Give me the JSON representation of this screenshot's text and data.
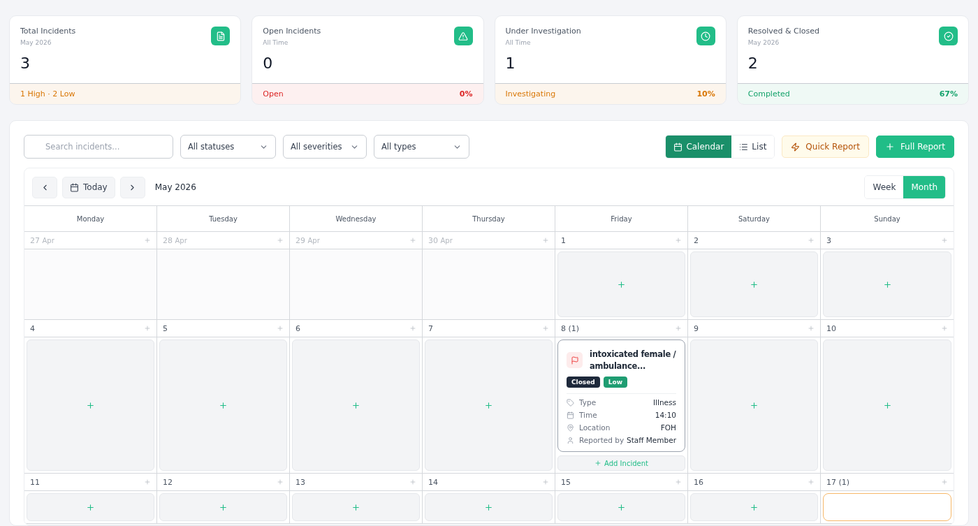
{
  "stats": [
    {
      "title": "Total Incidents",
      "subtitle": "May 2026",
      "value": "3",
      "color": "#d97706",
      "footer": "1 High · 2 Low"
    },
    {
      "title": "Open Incidents",
      "subtitle": "All Time",
      "value": "0",
      "color": "#dc2626",
      "footer": "Open",
      "percent": "0%"
    },
    {
      "title": "Under Investigation",
      "subtitle": "All Time",
      "value": "1",
      "color": "#d97706",
      "footer": "Investigating",
      "percent": "10%"
    },
    {
      "title": "Resolved & Closed",
      "subtitle": "May 2026",
      "value": "2",
      "color": "#16a36c",
      "footer": "Completed",
      "percent": "67%"
    }
  ],
  "filters": {
    "search_placeholder": "Search incidents...",
    "selects": [
      "All statuses",
      "All severities",
      "All types"
    ]
  },
  "view_tabs": [
    {
      "label": "Calendar",
      "selected": true
    },
    {
      "label": "List",
      "selected": false
    }
  ],
  "actions": [
    {
      "label": "Quick Report",
      "kind": "quick"
    },
    {
      "label": "Full Report",
      "kind": "full"
    }
  ],
  "calendar": {
    "today_label": "Today",
    "period": "May 2026",
    "range_tabs": [
      {
        "label": "Week",
        "selected": false
      },
      {
        "label": "Month",
        "selected": true
      }
    ],
    "weekdays": [
      "Monday",
      "Tuesday",
      "Wednesday",
      "Thursday",
      "Friday",
      "Saturday",
      "Sunday"
    ],
    "weeks": [
      [
        {
          "date": "27",
          "month": "Apr",
          "outside": true
        },
        {
          "date": "28",
          "month": "Apr",
          "outside": true
        },
        {
          "date": "29",
          "month": "Apr",
          "outside": true
        },
        {
          "date": "30",
          "month": "Apr",
          "outside": true
        },
        {
          "date": "1",
          "outside": false
        },
        {
          "date": "2",
          "outside": false
        },
        {
          "date": "3",
          "outside": false
        }
      ],
      [
        {
          "date": "4",
          "outside": false
        },
        {
          "date": "5",
          "outside": false
        },
        {
          "date": "6",
          "outside": false
        },
        {
          "date": "7",
          "outside": false
        },
        {
          "date": "8",
          "count": "(1)",
          "outside": false,
          "add_label": "Add Incident",
          "incidents": [
            {
              "title": "intoxicated female / ambulance...",
              "status": "Closed",
              "severity": "Low",
              "details": [
                {
                  "label": "Type",
                  "value": "Illness"
                },
                {
                  "label": "Time",
                  "value": "14:10"
                },
                {
                  "label": "Location",
                  "value": "FOH"
                },
                {
                  "label": "Reported by",
                  "value": "Staff Member"
                }
              ]
            }
          ]
        },
        {
          "date": "9",
          "outside": false
        },
        {
          "date": "10",
          "outside": false
        }
      ],
      [
        {
          "date": "11",
          "outside": false
        },
        {
          "date": "12",
          "outside": false
        },
        {
          "date": "13",
          "outside": false
        },
        {
          "date": "14",
          "outside": false
        },
        {
          "date": "15",
          "outside": false
        },
        {
          "date": "16",
          "outside": false
        },
        {
          "date": "17",
          "count": "(1)",
          "outside": false,
          "card_peek": true
        }
      ]
    ]
  }
}
